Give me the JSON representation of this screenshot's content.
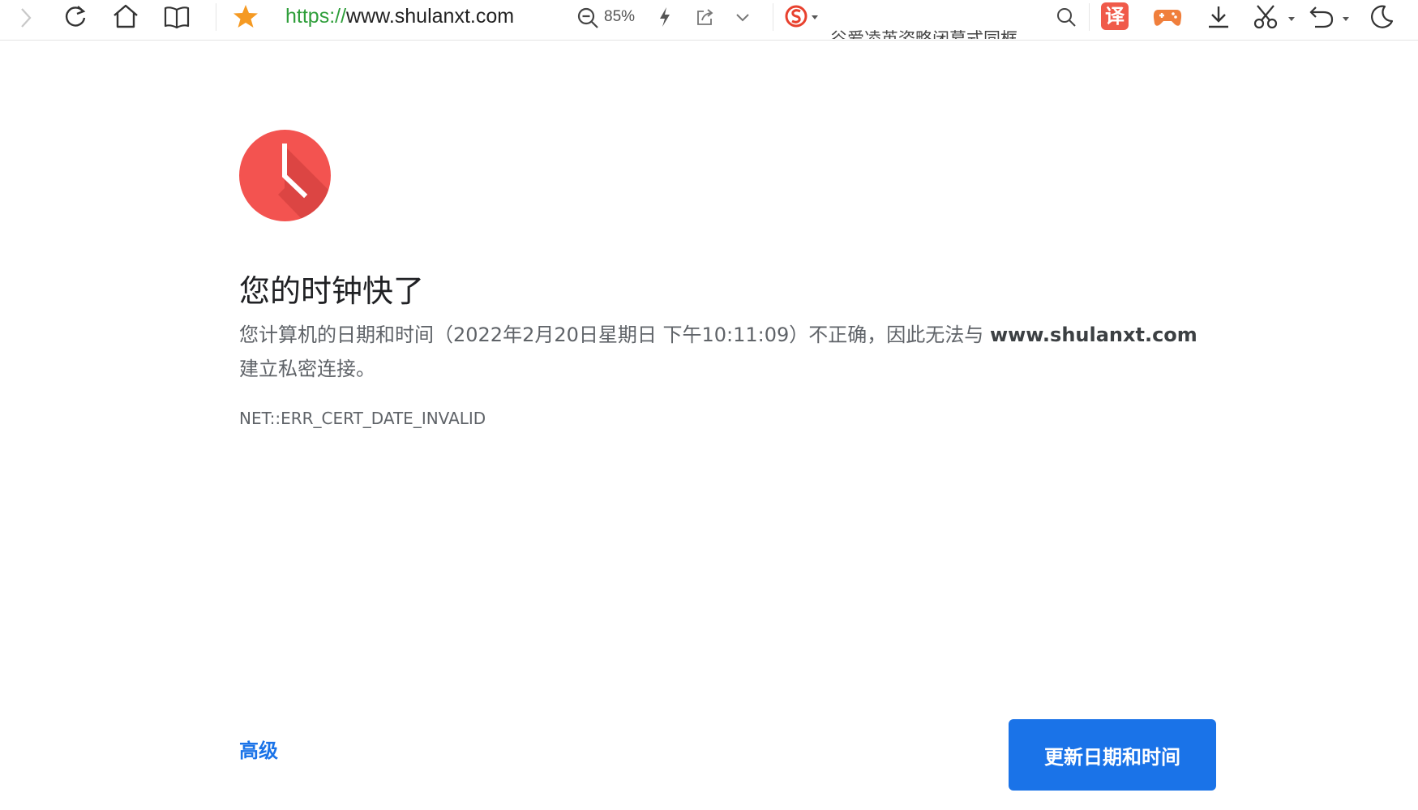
{
  "toolbar": {
    "url_scheme": "https://",
    "url_host": "www.shulanxt.com",
    "zoom_level": "85%",
    "clipped_banner_text": "谷爱凌英姿略闭幕式同框",
    "translate_badge": "译",
    "colors": {
      "star": "#f59a23",
      "url_scheme": "#2e9e3a",
      "translate_badge": "#f05a4a",
      "sogou": "#e8412e",
      "game": "#f07f3c"
    },
    "icons": [
      "forward-icon",
      "reload-icon",
      "home-icon",
      "reader-icon",
      "star-icon",
      "zoom-icon",
      "lightning-icon",
      "share-icon",
      "chevron-down-icon",
      "sogou-icon",
      "search-icon",
      "translate-icon",
      "game-icon",
      "download-icon",
      "scissors-icon",
      "undo-icon",
      "night-mode-icon"
    ]
  },
  "error": {
    "icon": "clock-icon",
    "icon_color": "#f35350",
    "title": "您的时钟快了",
    "desc_before": "您计算机的日期和时间（2022年2月20日星期日 下午10:11:09）不正确，因此无法与 ",
    "desc_host": "www.shulanxt.com",
    "desc_after": " 建立私密连接。",
    "code": "NET::ERR_CERT_DATE_INVALID"
  },
  "actions": {
    "advanced_label": "高级",
    "primary_label": "更新日期和时间",
    "primary_color": "#1a73e8"
  }
}
